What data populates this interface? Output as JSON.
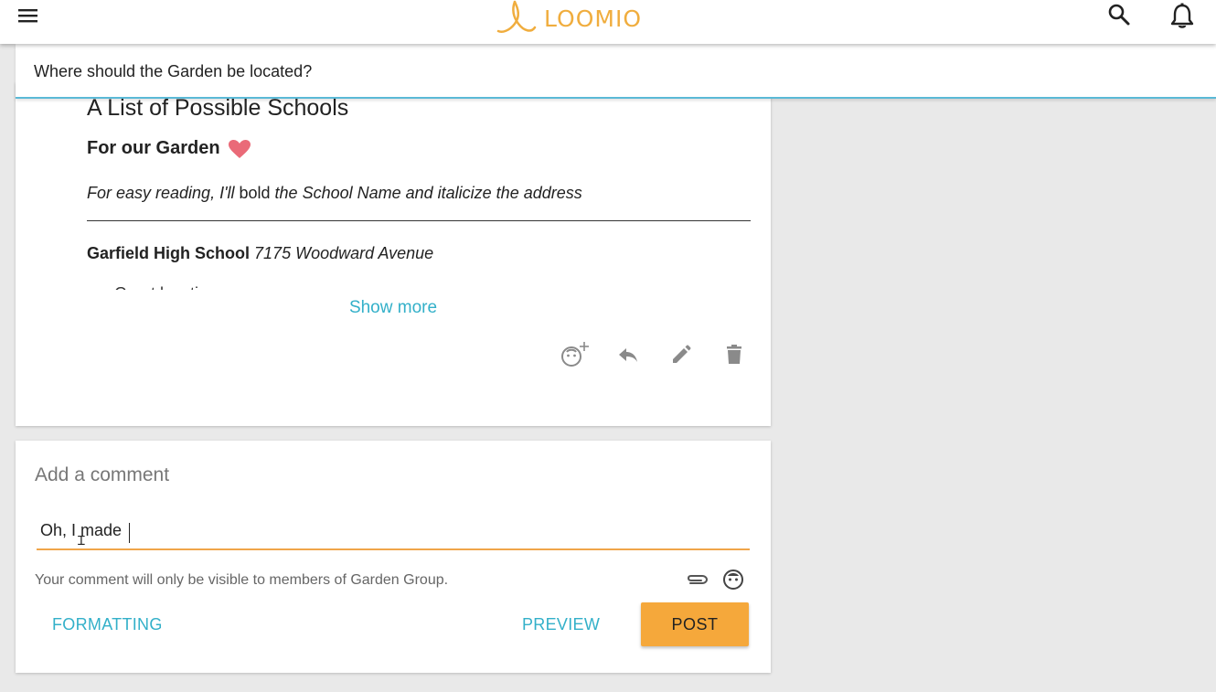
{
  "brand": {
    "name": "LOOMIO",
    "color": "#f0ad3e"
  },
  "topbar": {
    "menu_icon": "hamburger-menu-icon",
    "search_icon": "search-icon",
    "notifications_icon": "bell-icon"
  },
  "context": {
    "title": "Where should the Garden be located?"
  },
  "document": {
    "heading": "A List of Possible Schools",
    "subheading": "For our Garden",
    "heart_icon": "heart-icon",
    "intro_before": "For easy reading, I'll ",
    "intro_bold": "bold",
    "intro_after": " the School Name and italicize the address",
    "school_name": "Garfield High School",
    "school_address": "7175 Woodward Avenue",
    "cutoff_text": "Great location",
    "show_more": "Show more"
  },
  "actions": [
    {
      "name": "add-reaction",
      "icon": "add-reaction-icon"
    },
    {
      "name": "reply",
      "icon": "reply-icon"
    },
    {
      "name": "edit",
      "icon": "pencil-icon"
    },
    {
      "name": "delete",
      "icon": "trash-icon"
    }
  ],
  "comment": {
    "title": "Add a comment",
    "value": "Oh, I made ",
    "visibility_note": "Your comment will only be visible to members of Garden Group.",
    "attach_icon": "paperclip-icon",
    "emoji_icon": "emoji-icon",
    "formatting_label": "FORMATTING",
    "preview_label": "PREVIEW",
    "post_label": "POST"
  },
  "colors": {
    "accent": "#33b0c9",
    "post_button": "#f5a83b",
    "input_underline": "#f0a54a",
    "context_underline": "#5ab9d6"
  }
}
